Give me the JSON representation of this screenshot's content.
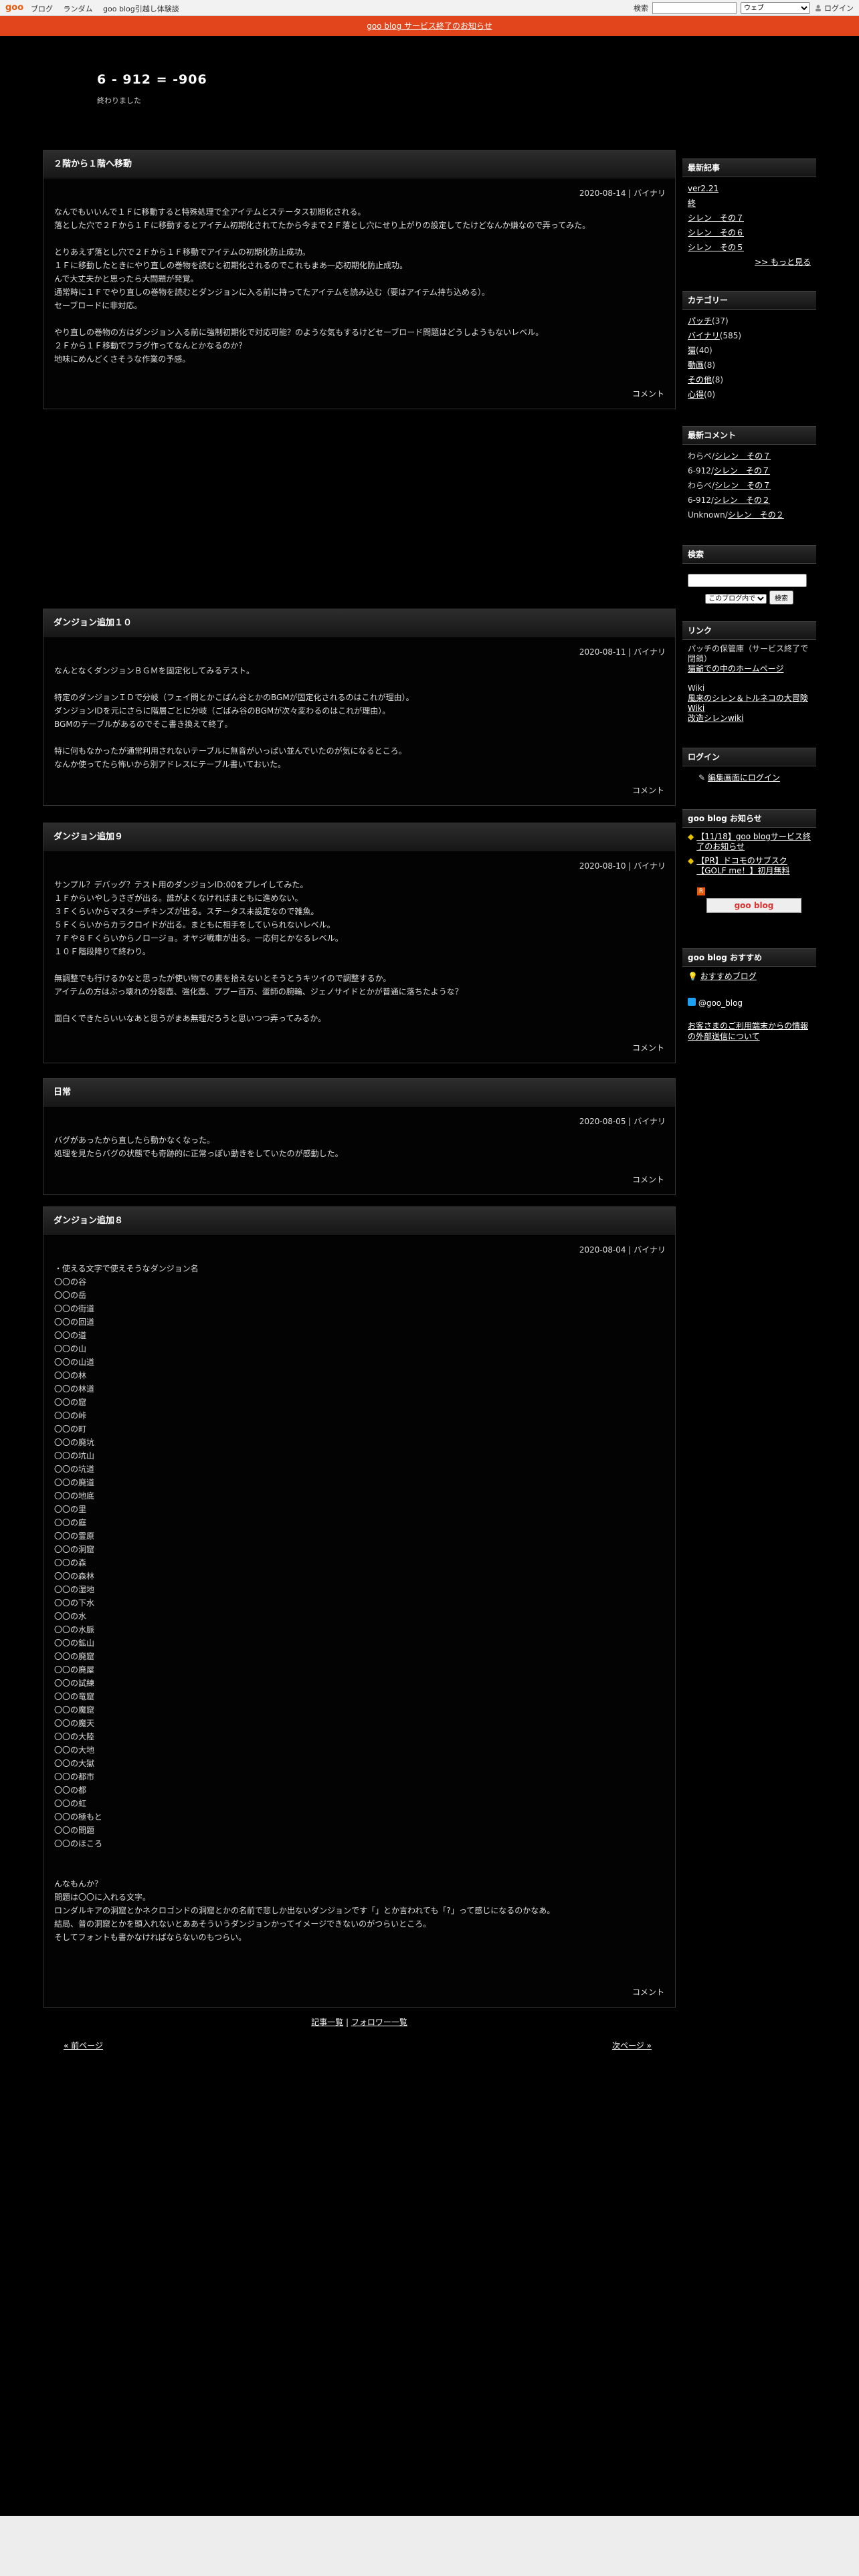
{
  "topbar": {
    "logo": "goo",
    "nav": [
      "ブログ",
      "ランダム",
      "goo blog引越し体験談"
    ],
    "search_label": "検索",
    "search_select": "ウェブ",
    "login": "ログイン"
  },
  "notice": "goo blog サービス終了のお知らせ",
  "blog": {
    "title": "6 - 912 = -906",
    "description": "終わりました"
  },
  "entries": [
    {
      "title": "２階から１階へ移動",
      "meta": "2020-08-14 | バイナリ",
      "lines": [
        "なんでもいいんで１Ｆに移動すると特殊処理で全アイテムとステータス初期化される。",
        "落とした穴で２Ｆから１Ｆに移動するとアイテム初期化されてたから今まで２Ｆ落とし穴にせり上がりの設定してたけどなんか嫌なので弄ってみた。",
        "",
        "とりあえず落とし穴で２Ｆから１Ｆ移動でアイテムの初期化防止成功。",
        "１Ｆに移動したときにやり直しの巻物を読むと初期化されるのでこれもまあ一応初期化防止成功。",
        "んで大丈夫かと思ったら大問題が発覚。",
        "通常時に１Ｆでやり直しの巻物を読むとダンジョンに入る前に持ってたアイテムを読み込む（要はアイテム持ち込める）。",
        "セーブロードに非対応。",
        "",
        "やり直しの巻物の方はダンジョン入る前に強制初期化で対応可能？のような気もするけどセーブロード問題はどうしようもないレベル。",
        "２Ｆから１Ｆ移動でフラグ作ってなんとかなるのか？",
        "地味にめんどくさそうな作業の予感。"
      ],
      "footer": "コメント"
    },
    {
      "title": "ダンジョン追加１０",
      "meta": "2020-08-11 | バイナリ",
      "lines": [
        "なんとなくダンジョンＢＧＭを固定化してみるテスト。",
        "",
        "特定のダンジョンＩＤで分岐（フェイ問とかこばん谷とかのBGMが固定化されるのはこれが理由）。",
        "ダンジョンIDを元にさらに階層ごとに分岐（ごばみ谷のBGMが次々変わるのはこれが理由）。",
        "BGMのテーブルがあるのでそこ書き換えて終了。",
        "",
        "特に何もなかったが通常利用されないテーブルに無音がいっぱい並んでいたのが気になるところ。",
        "なんか使ってたら怖いから別アドレスにテーブル書いておいた。"
      ],
      "footer": "コメント"
    },
    {
      "title": "ダンジョン追加９",
      "meta": "2020-08-10 | バイナリ",
      "lines": [
        "サンプル？デバッグ？テスト用のダンジョンID:00をプレイしてみた。",
        "１Ｆからいやしうさぎが出る。誰がよくなければまともに進めない。",
        "３Ｆくらいからマスターチキンズが出る。ステータス未設定なので雑魚。",
        "５Ｆくらいからカラクロイドが出る。まともに相手をしていられないレベル。",
        "７Ｆや８Ｆくらいからノロージョ。オヤジ戦車が出る。一応何とかなるレベル。",
        "１０Ｆ階段降りて終わり。",
        "",
        "無調整でも行けるかなと思ったが使い物での素を拾えないとそうとうキツイので調整するか。",
        "アイテムの方はぶっ壊れの分裂壺、強化壺、ププー百万、蛋師の腕輪、ジェノサイドとかが普通に落ちたような？",
        "",
        "面白くできたらいいなあと思うがまあ無理だろうと思いつつ弄ってみるか。"
      ],
      "footer": "コメント"
    },
    {
      "title": "日常",
      "meta": "2020-08-05 | バイナリ",
      "lines": [
        "バグがあったから直したら動かなくなった。",
        "処理を見たらバグの状態でも奇跡的に正常っぽい動きをしていたのが感動した。"
      ],
      "footer": "コメント"
    },
    {
      "title": "ダンジョン追加８",
      "meta": "2020-08-04 | バイナリ",
      "lines": [
        "・使える文字で使えそうなダンジョン名",
        "〇〇の谷",
        "〇〇の岳",
        "〇〇の街道",
        "〇〇の回道",
        "〇〇の道",
        "〇〇の山",
        "〇〇の山道",
        "〇〇の林",
        "〇〇の林道",
        "〇〇の窟",
        "〇〇の峠",
        "〇〇の町",
        "〇〇の廃坑",
        "〇〇の坑山",
        "〇〇の坑道",
        "〇〇の廃道",
        "〇〇の地底",
        "〇〇の里",
        "〇〇の庭",
        "〇〇の霊原",
        "〇〇の洞窟",
        "〇〇の森",
        "〇〇の森林",
        "〇〇の湿地",
        "〇〇の下水",
        "〇〇の水",
        "〇〇の水脈",
        "〇〇の鉱山",
        "〇〇の廃窟",
        "〇〇の廃屋",
        "〇〇の試練",
        "〇〇の竜窟",
        "〇〇の魔窟",
        "〇〇の魔天",
        "〇〇の大陸",
        "〇〇の大地",
        "〇〇の大獄",
        "〇〇の都市",
        "〇〇の都",
        "〇〇の虹",
        "〇〇の極もと",
        "〇〇の問題",
        "〇〇のほころ",
        "",
        "",
        "んなもんか？",
        "問題は〇〇に入れる文字。",
        "ロンダルキアの洞窟とかネクロゴンドの洞窟とかの名前で悲しか出ないダンジョンです「」とか言われても「?」って感じになるのかなあ。",
        "結局、普の洞窟とかを頭入れないとああそういうダンジョンかってイメージできないのがつらいところ。",
        "そしてフォントも書かなければならないのもつらい。"
      ],
      "footer": "コメント"
    }
  ],
  "pager": {
    "list": "記事一覧",
    "sep": "|",
    "followers": "フォロワー一覧",
    "prev": "« 前ページ",
    "next": "次ページ »"
  },
  "sidebar": {
    "recent": {
      "title": "最新記事",
      "items": [
        "ver2.21",
        "終",
        "シレン　その７",
        "シレン　その６",
        "シレン　その５"
      ],
      "more": ">> もっと見る"
    },
    "categories": {
      "title": "カテゴリー",
      "items": [
        {
          "name": "パッチ",
          "count": "(37)"
        },
        {
          "name": "バイナリ",
          "count": "(585)"
        },
        {
          "name": "猫",
          "count": "(40)"
        },
        {
          "name": "動画",
          "count": "(8)"
        },
        {
          "name": "その他",
          "count": "(8)"
        },
        {
          "name": "心得",
          "count": "(0)"
        }
      ]
    },
    "comments": {
      "title": "最新コメント",
      "items": [
        {
          "who": "わらべ",
          "post": "シレン　その７"
        },
        {
          "who": "6-912",
          "post": "シレン　その７"
        },
        {
          "who": "わらべ",
          "post": "シレン　その７"
        },
        {
          "who": "6-912",
          "post": "シレン　その２"
        },
        {
          "who": "Unknown",
          "post": "シレン　その２"
        }
      ]
    },
    "search": {
      "title": "検索",
      "select": "このブログ内で",
      "button": "検索"
    },
    "links": {
      "title": "リンク",
      "line1": "パッチの保管庫（サービス終了で閉鎖）",
      "link1": "猫爺での中のホームページ",
      "wiki": "Wiki",
      "link2": "風来のシレン＆トルネコの大冒険 Wiki",
      "link3": "改造シレンwiki"
    },
    "login": {
      "title": "ログイン",
      "link": "編集画面にログイン"
    },
    "notices": {
      "title": "goo blog お知らせ",
      "item1": "【11/18】goo blogサービス終了のお知らせ",
      "item2": "【PR】ドコモのサブスク【GOLF me！】初月無料",
      "button": "goo blog"
    },
    "recommend": {
      "title": "goo blog おすすめ",
      "item": "おすすめブログ",
      "twitter": "@goo_blog",
      "info": "お客さまのご利用端末からの情報の外部送信について"
    }
  }
}
